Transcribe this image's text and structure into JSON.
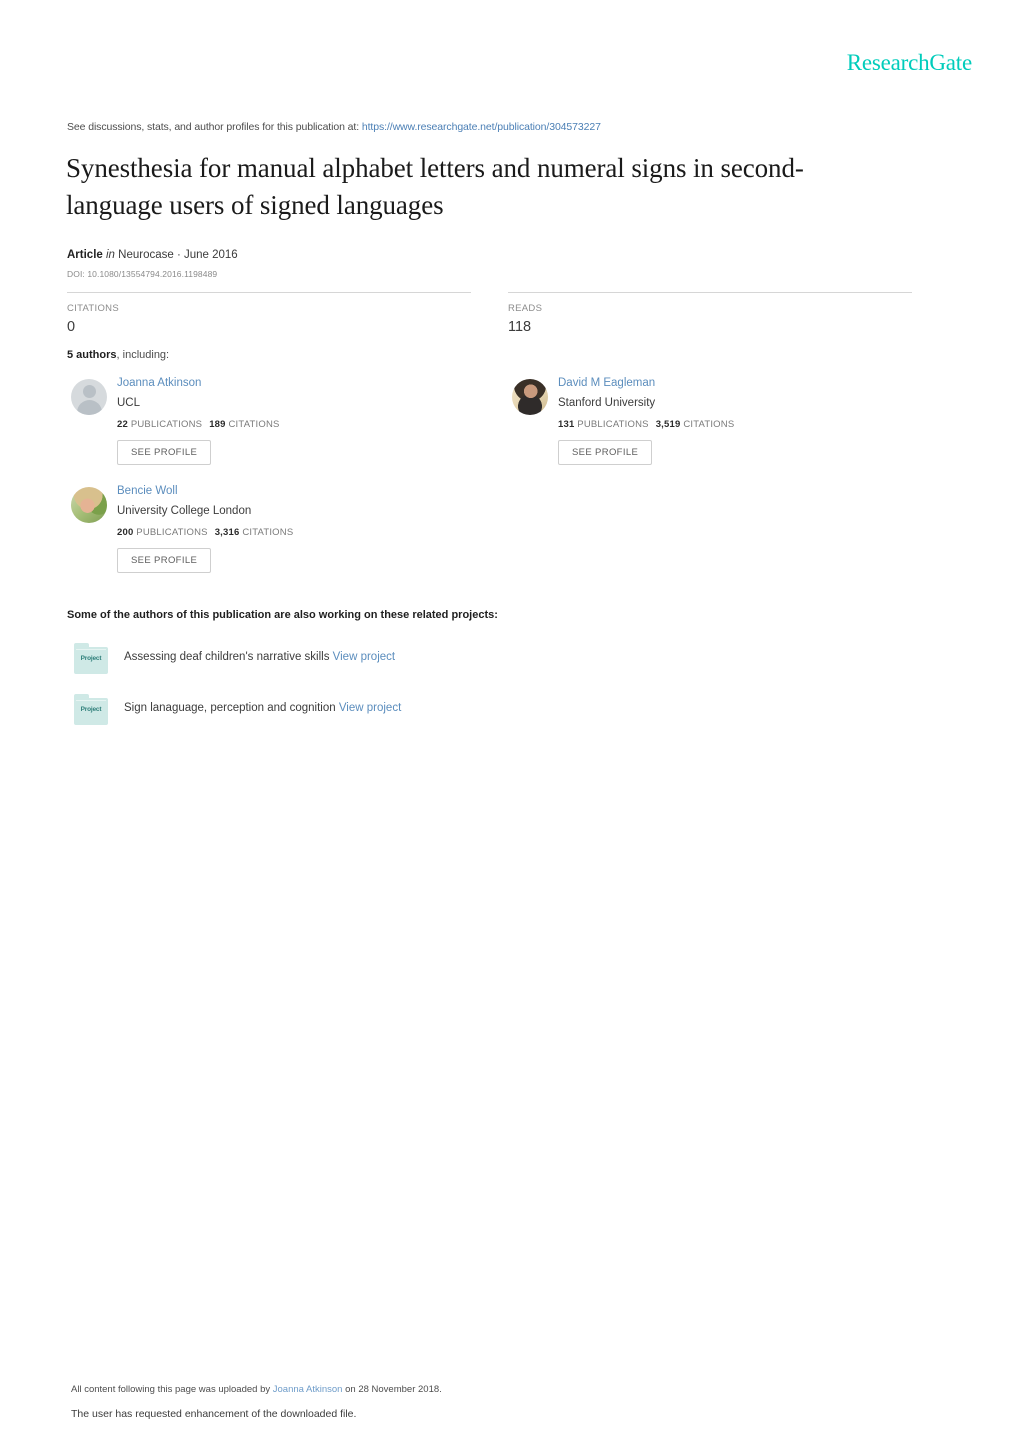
{
  "brand": {
    "name": "ResearchGate",
    "color": "#00ccbb"
  },
  "discussion": {
    "prefix": "See discussions, stats, and author profiles for this publication at:",
    "url": "https://www.researchgate.net/publication/304573227"
  },
  "publication": {
    "title": "Synesthesia for manual alphabet letters and numeral signs in second-language users of signed languages",
    "type_label": "Article",
    "in_word": "in",
    "venue": "Neurocase · June 2016",
    "doi": "DOI: 10.1080/13554794.2016.1198489"
  },
  "stats": [
    {
      "label": "CITATIONS",
      "value": "0"
    },
    {
      "label": "READS",
      "value": "118"
    }
  ],
  "authors_heading": {
    "count": "5 authors",
    "rest": ", including:"
  },
  "authors": [
    {
      "name": "Joanna Atkinson",
      "affiliation": "UCL",
      "publications": "22",
      "publications_label": "PUBLICATIONS",
      "citations": "189",
      "citations_label": "CITATIONS",
      "button": "SEE PROFILE",
      "avatar": "avatar-placeholder"
    },
    {
      "name": "David M Eagleman",
      "affiliation": "Stanford University",
      "publications": "131",
      "publications_label": "PUBLICATIONS",
      "citations": "3,519",
      "citations_label": "CITATIONS",
      "button": "SEE PROFILE",
      "avatar": "avatar-photo"
    },
    {
      "name": "Bencie Woll",
      "affiliation": "University College London",
      "publications": "200",
      "publications_label": "PUBLICATIONS",
      "citations": "3,316",
      "citations_label": "CITATIONS",
      "button": "SEE PROFILE",
      "avatar": "avatar-photo"
    }
  ],
  "projects": {
    "heading": "Some of the authors of this publication are also working on these related projects:",
    "icon_label": "Project",
    "items": [
      {
        "title": "Assessing deaf children's narrative skills",
        "link": "View project"
      },
      {
        "title": "Sign lanaguage, perception and cognition",
        "link": "View project"
      }
    ]
  },
  "footer": {
    "upload_prefix": "All content following this page was uploaded by ",
    "uploader": "Joanna Atkinson",
    "upload_suffix": " on 28 November 2018.",
    "enhancement": "The user has requested enhancement of the downloaded file."
  }
}
